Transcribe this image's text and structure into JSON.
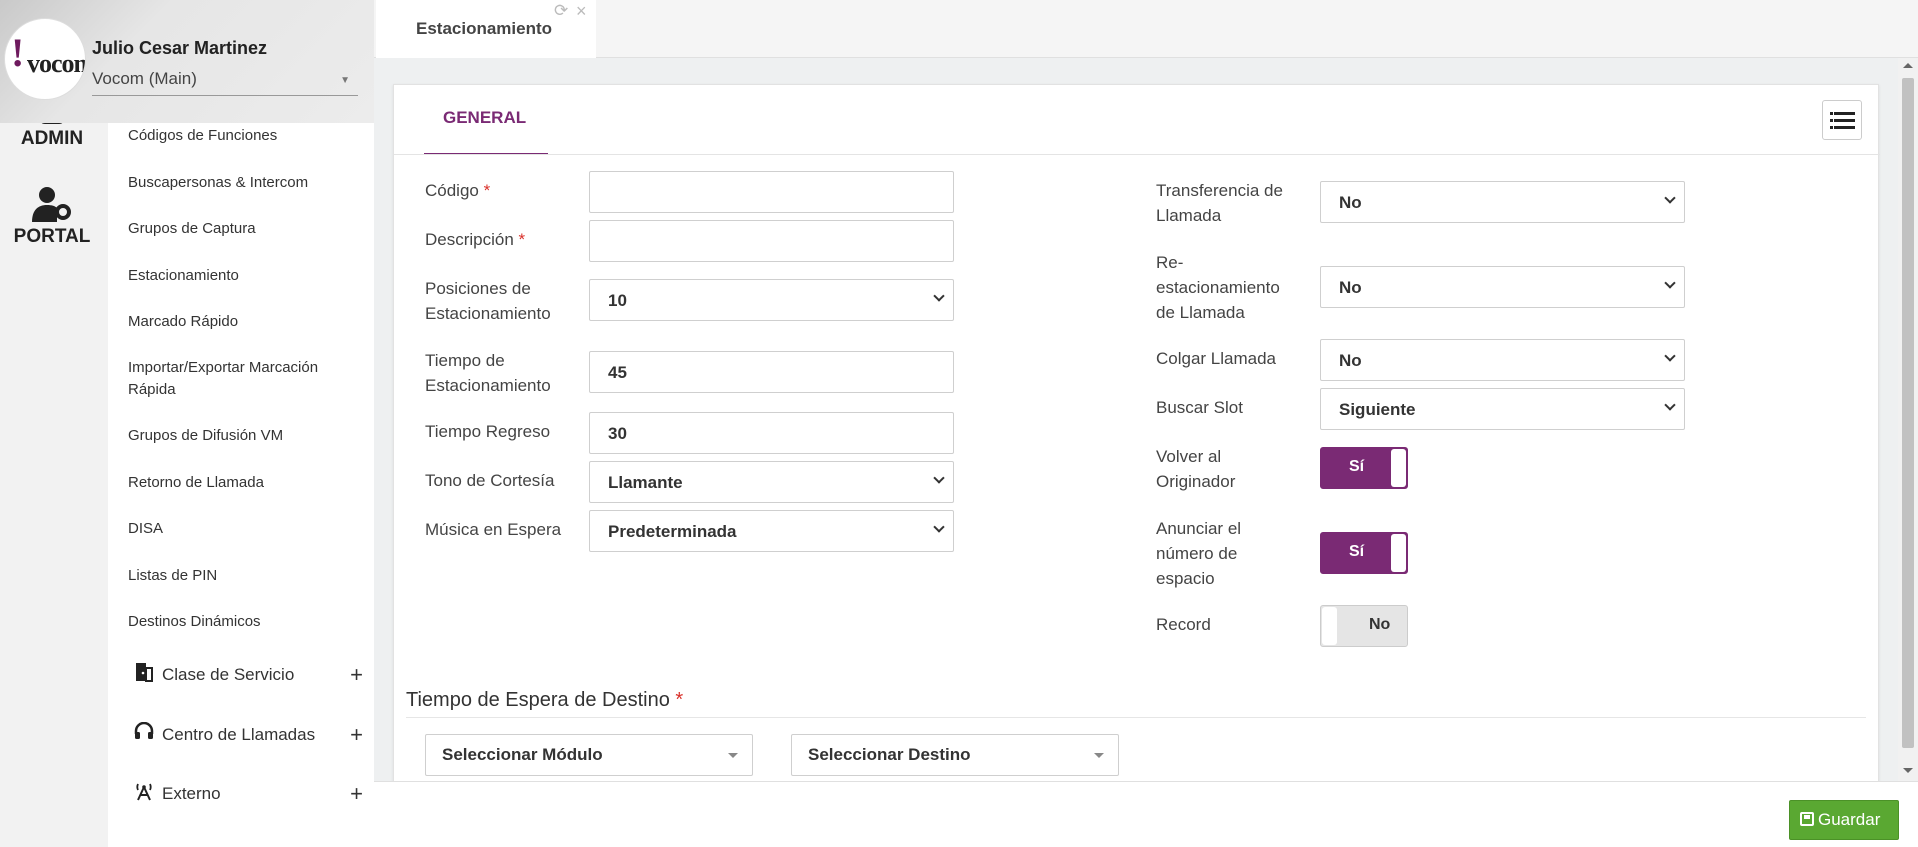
{
  "user": {
    "name": "Julio Cesar Martinez",
    "tenant": "Vocom (Main)",
    "logo_text": "vocom"
  },
  "rail": {
    "admin_label": "ADMIN",
    "portal_label": "PORTAL"
  },
  "sidebar": {
    "links": [
      "Códigos de Funciones",
      "Buscapersonas & Intercom",
      "Grupos de Captura",
      "Estacionamiento",
      "Marcado Rápido",
      "Importar/Exportar Marcación Rápida",
      "Grupos de Difusión VM",
      "Retorno de Llamada",
      "DISA",
      "Listas de PIN",
      "Destinos Dinámicos"
    ],
    "groups": [
      {
        "label": "Clase de Servicio",
        "icon": "door-icon"
      },
      {
        "label": "Centro de Llamadas",
        "icon": "headset-icon"
      },
      {
        "label": "Externo",
        "icon": "antenna-icon"
      }
    ]
  },
  "tabs": {
    "active_label": "Estacionamiento"
  },
  "panel": {
    "tab_label": "GENERAL",
    "left_fields": {
      "codigo_label": "Código",
      "codigo_value": "",
      "descripcion_label": "Descripción",
      "descripcion_value": "",
      "posiciones_label": "Posiciones de Estacionamiento",
      "posiciones_value": "10",
      "tiempo_est_label": "Tiempo de Estacionamiento",
      "tiempo_est_value": "45",
      "tiempo_regreso_label": "Tiempo Regreso",
      "tiempo_regreso_value": "30",
      "tono_label": "Tono de Cortesía",
      "tono_value": "Llamante",
      "musica_label": "Música en Espera",
      "musica_value": "Predeterminada"
    },
    "right_fields": {
      "transferencia_label": "Transferencia de Llamada",
      "transferencia_value": "No",
      "reest_label": "Re-estacionamiento de Llamada",
      "reest_value": "No",
      "colgar_label": "Colgar Llamada",
      "colgar_value": "No",
      "buscar_label": "Buscar Slot",
      "buscar_value": "Siguiente",
      "volver_label": "Volver al Originador",
      "volver_value": "Sí",
      "anunciar_label": "Anunciar el número de espacio",
      "anunciar_value": "Sí",
      "record_label": "Record",
      "record_value": "No"
    },
    "destination": {
      "title": "Tiempo de Espera de Destino",
      "module_placeholder": "Seleccionar Módulo",
      "destination_placeholder": "Seleccionar Destino"
    }
  },
  "footer": {
    "save_label": "Guardar"
  },
  "colors": {
    "accent": "#7a2a74",
    "save": "#5aa832",
    "required": "#d9302a"
  }
}
